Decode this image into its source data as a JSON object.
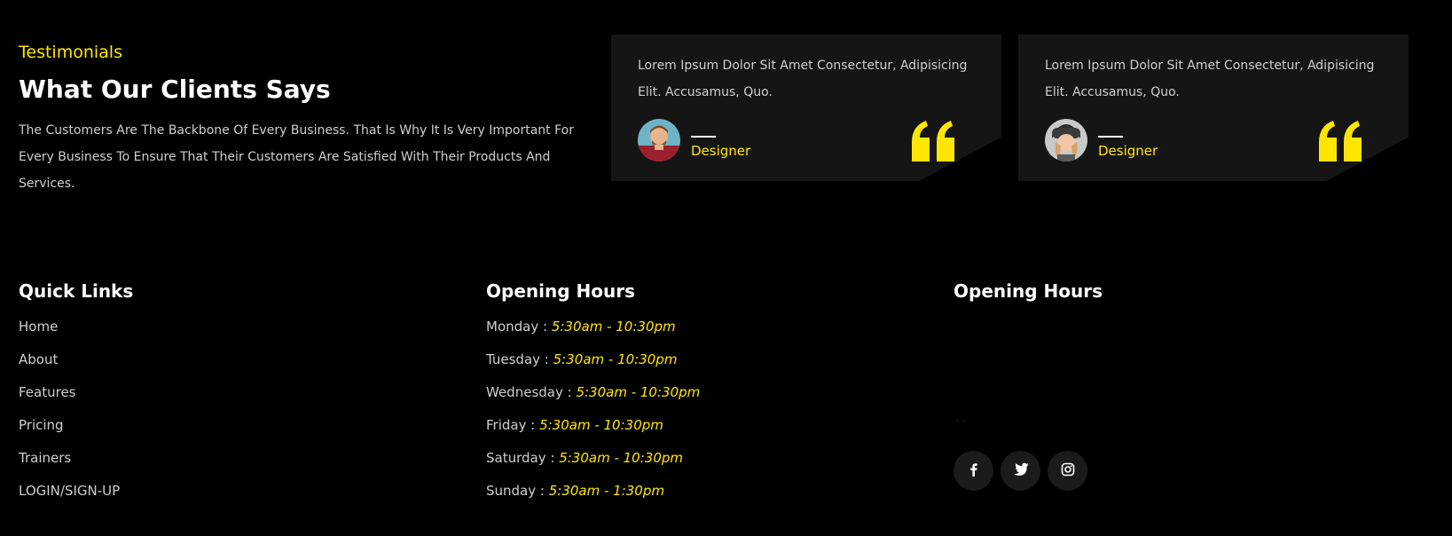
{
  "testimonials": {
    "eyebrow": "Testimonials",
    "title": "What Our Clients Says",
    "description": "The Customers Are The Backbone Of Every Business. That Is Why It Is Very Important For Every Business To Ensure That Their Customers Are Satisfied With Their Products And Services.",
    "cards": [
      {
        "quote": "Lorem Ipsum Dolor Sit Amet Consectetur, Adipisicing Elit. Accusamus, Quo.",
        "role": "Designer",
        "avatar": "man-avatar",
        "quote_icon": "quote-icon"
      },
      {
        "quote": "Lorem Ipsum Dolor Sit Amet Consectetur, Adipisicing Elit. Accusamus, Quo.",
        "role": "Designer",
        "avatar": "woman-avatar",
        "quote_icon": "quote-icon"
      }
    ]
  },
  "footer": {
    "quick_links": {
      "title": "Quick Links",
      "items": [
        "Home",
        "About",
        "Features",
        "Pricing",
        "Trainers",
        "LOGIN/SIGN-UP"
      ]
    },
    "opening_hours": {
      "title": "Opening Hours",
      "items": [
        {
          "day": "Monday :",
          "time": "5:30am - 10:30pm"
        },
        {
          "day": "Tuesday :",
          "time": "5:30am - 10:30pm"
        },
        {
          "day": "Wednesday :",
          "time": "5:30am - 10:30pm"
        },
        {
          "day": "Friday :",
          "time": "5:30am - 10:30pm"
        },
        {
          "day": "Saturday :",
          "time": "5:30am - 10:30pm"
        },
        {
          "day": "Sunday :",
          "time": "5:30am - 1:30pm"
        }
      ]
    },
    "third_column": {
      "title": "Opening Hours",
      "socials": [
        "facebook-icon",
        "twitter-icon",
        "instagram-icon"
      ]
    }
  },
  "colors": {
    "accent": "#ffe600",
    "background": "#000000",
    "card": "#151515",
    "text_muted": "#cfcfcf"
  }
}
